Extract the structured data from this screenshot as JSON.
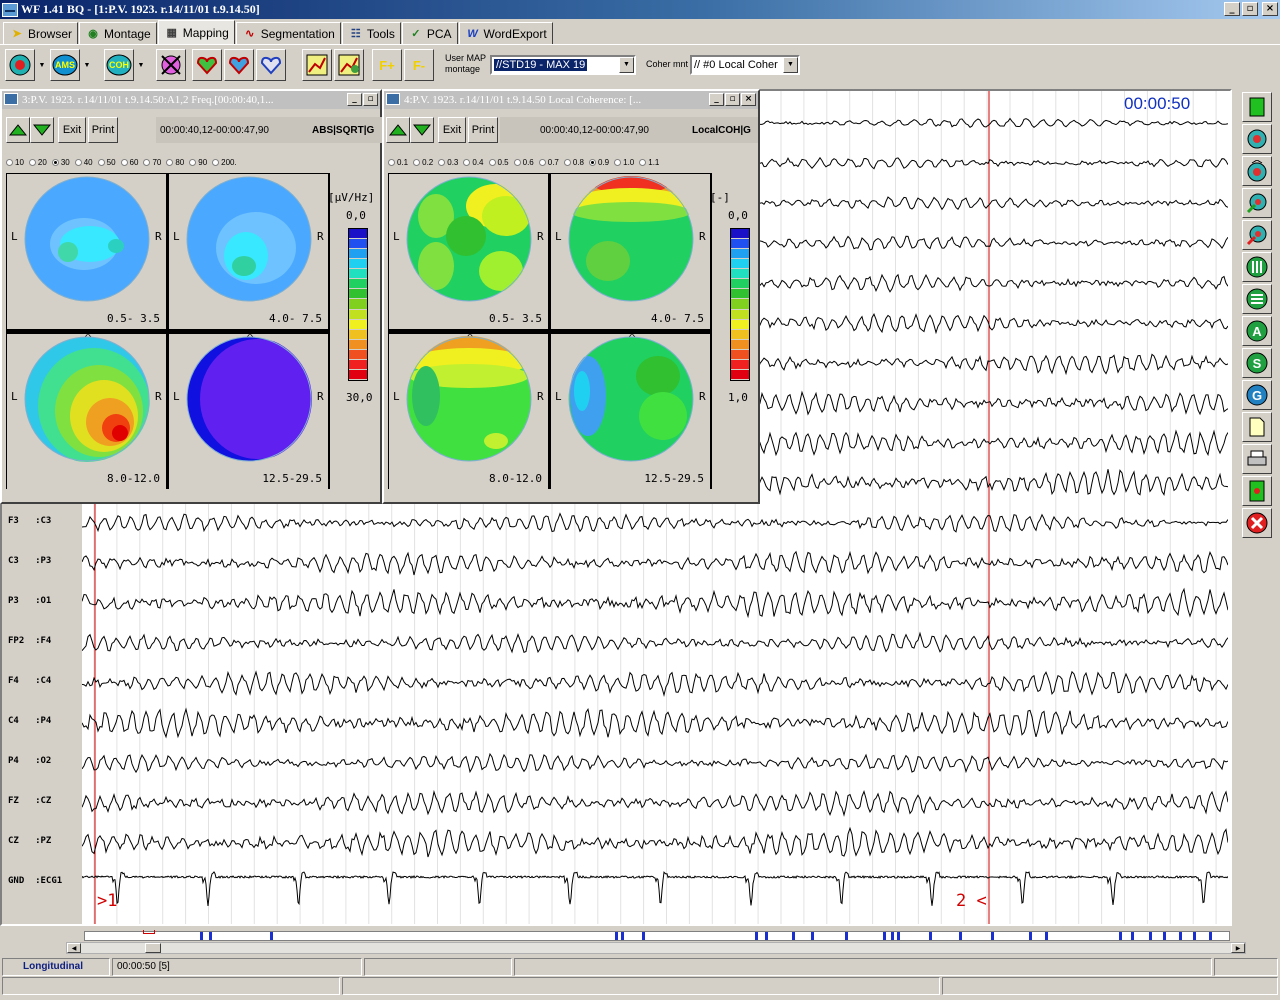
{
  "window": {
    "title": "WF 1.41 BQ - [1:P.V. 1923. r.14/11/01 t.9.14.50]"
  },
  "menu": [
    {
      "label": "Browser",
      "icon": "arrow-icon"
    },
    {
      "label": "Montage",
      "icon": "montage-icon"
    },
    {
      "label": "Mapping",
      "icon": "mapping-icon"
    },
    {
      "label": "Segmentation",
      "icon": "segmentation-icon"
    },
    {
      "label": "Tools",
      "icon": "tools-icon"
    },
    {
      "label": "PCA",
      "icon": "pca-icon"
    },
    {
      "label": "WordExport",
      "icon": "word-icon"
    }
  ],
  "toolbar": {
    "btn_ams": "AMS",
    "btn_coh": "COH",
    "btn_fplus": "F+",
    "btn_fminus": "F-",
    "usermap_label_1": "User MAP",
    "usermap_label_2": "montage",
    "usermap_value": "//STD19 - MAX 19",
    "coher_label": "Coher mnt",
    "coher_value": "// #0 Local Coher"
  },
  "eeg": {
    "timecode": "00:00:50",
    "channels": [
      "F3   :C3",
      "C3   :P3",
      "P3   :O1",
      "FP2  :F4",
      "F4   :C4",
      "C4   :P4",
      "P4   :O2",
      "FZ   :CZ",
      "CZ   :PZ",
      "GND  :ECG1"
    ],
    "marker_start": ">1",
    "marker_end": "2 <"
  },
  "map_power": {
    "title": "3:P.V. 1923. r.14/11/01 t.9.14.50:A1,2 Freq.[00:00:40,1...",
    "exit": "Exit",
    "print": "Print",
    "range": "00:00:40,12-00:00:47,90",
    "mode": "ABS|SQRT|G",
    "scale_ticks": [
      "10",
      "20",
      "30",
      "40",
      "50",
      "60",
      "70",
      "80",
      "90",
      "200."
    ],
    "scale_selected": "30",
    "unit": "[µV/Hz]",
    "min": "0,0",
    "max": "30,0",
    "bands": [
      "0.5- 3.5",
      "4.0- 7.5",
      "8.0-12.0",
      "12.5-29.5"
    ],
    "left_label": "L",
    "right_label": "R"
  },
  "map_coh": {
    "title": "4:P.V. 1923. r.14/11/01 t.9.14.50 Local Coherence: [...",
    "exit": "Exit",
    "print": "Print",
    "range": "00:00:40,12-00:00:47,90",
    "mode": "LocalCOH|G",
    "scale_ticks": [
      "0.1",
      "0.2",
      "0.3",
      "0.4",
      "0.5",
      "0.6",
      "0.7",
      "0.8",
      "0.9",
      "1.0",
      "1.1"
    ],
    "scale_selected": "0.9",
    "unit": "[-]",
    "min": "0,0",
    "max": "1,0",
    "bands": [
      "0.5- 3.5",
      "4.0- 7.5",
      "8.0-12.0",
      "12.5-29.5"
    ],
    "left_label": "L",
    "right_label": "R"
  },
  "status": {
    "montage": "Longitudinal",
    "time": "00:00:50 [5]"
  },
  "colors": {
    "trace": "#000000",
    "marker": "#d00000",
    "timecode": "#1030c0",
    "nav_mark": "#1a2fd0",
    "colorbar": [
      "#1a10c8",
      "#2050f0",
      "#20a0f0",
      "#20d0f0",
      "#20e0c0",
      "#20d060",
      "#30c030",
      "#80d020",
      "#c0e020",
      "#f0f020",
      "#f0c020",
      "#f09020",
      "#f05020",
      "#f02020",
      "#e00010"
    ]
  }
}
